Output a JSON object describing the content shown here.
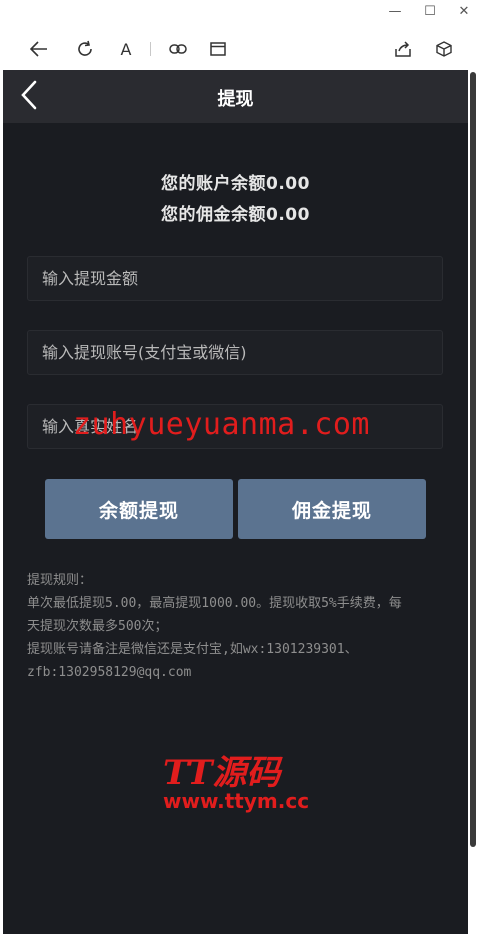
{
  "window": {
    "minimize_glyph": "—",
    "maximize_glyph": "☐",
    "close_glyph": "✕"
  },
  "toolbar": {
    "icons": [
      "back-arrow-icon",
      "refresh-icon",
      "text-size-icon",
      "link-icon",
      "window-icon",
      "share-icon",
      "cube-icon"
    ],
    "text_size_glyph": "A"
  },
  "header": {
    "title": "提现"
  },
  "balance": {
    "account": "您的账户余额0.00",
    "commission": "您的佣金余额0.00"
  },
  "form": {
    "amount_placeholder": "输入提现金额",
    "account_placeholder": "输入提现账号(支付宝或微信)",
    "name_placeholder": "输入真实姓名"
  },
  "buttons": {
    "balance_withdraw": "余额提现",
    "commission_withdraw": "佣金提现"
  },
  "rules": {
    "title": "提现规则：",
    "line1": "单次最低提现5.00，最高提现1000.00。提现收取5%手续费，每",
    "line2": "天提现次数最多500次；",
    "line3": "提现账号请备注是微信还是支付宝,如wx:1301239301、",
    "line4": "zfb:1302958129@qq.com"
  },
  "watermarks": {
    "center": "zuhyueyuanma.com",
    "logo_text": "TT源码",
    "logo_url": "www.ttym.cc"
  },
  "colors": {
    "background": "#1a1c21",
    "navbar": "#2a2b30",
    "button": "#5b7390",
    "watermark": "#e11d1d"
  }
}
